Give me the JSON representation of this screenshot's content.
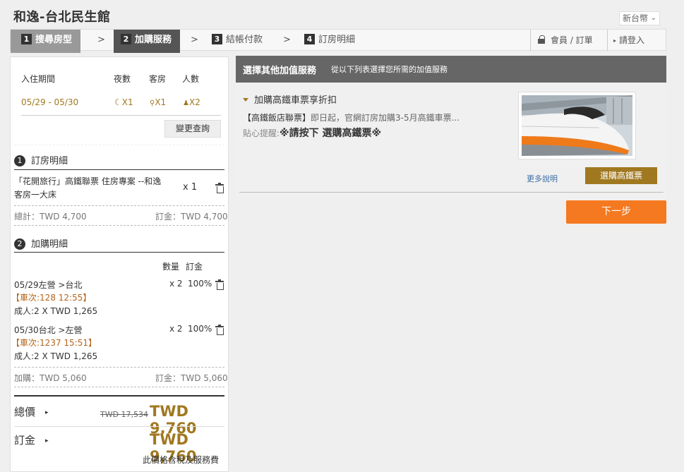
{
  "header": {
    "hotel_name": "和逸-台北民生館",
    "currency": "新台幣"
  },
  "steps": [
    {
      "num": "1",
      "label": "搜尋房型"
    },
    {
      "num": "2",
      "label": "加購服務"
    },
    {
      "num": "3",
      "label": "結帳付款"
    },
    {
      "num": "4",
      "label": "訂房明細"
    }
  ],
  "nav": {
    "member_orders": "會員 / 訂單",
    "login": "請登入",
    "arrow": ">"
  },
  "booking": {
    "headers": {
      "period": "入住期間",
      "nights": "夜數",
      "rooms": "客房",
      "guests": "人數"
    },
    "period": "05/29 - 05/30",
    "nights": "X1",
    "rooms": "X1",
    "guests": "X2",
    "change_button": "變更查詢"
  },
  "room_detail": {
    "section_num": "1",
    "title": "訂房明細",
    "item_line1": "「花開旅行」高鐵聯票 住房專案 --和逸",
    "item_line2": "客房一大床",
    "qty": "x 1",
    "subtotal": "總計：TWD 4,700",
    "deposit": "訂金：TWD 4,700"
  },
  "addon_detail": {
    "section_num": "2",
    "title": "加購明細",
    "col_qty": "數量",
    "col_deposit": "訂金",
    "items": [
      {
        "route": "05/29左營 >台北",
        "train": "【車次:128 12:55】",
        "fare": "成人:2 X TWD 1,265",
        "qty": "x 2",
        "pct": "100%"
      },
      {
        "route": "05/30台北 >左營",
        "train": "【車次:1237 15:51】",
        "fare": "成人:2 X TWD 1,265",
        "qty": "x 2",
        "pct": "100%"
      }
    ],
    "subtotal": "加購：TWD 5,060",
    "deposit": "訂金：TWD 5,060"
  },
  "totals": {
    "total_label": "總價",
    "original_price": "TWD 17,534",
    "total_price": "TWD 9,760",
    "deposit_label": "訂金",
    "deposit_price": "TWD 9,760",
    "tax_note": "此價格含稅及服務費"
  },
  "addon_panel": {
    "header_title": "選擇其他加值服務",
    "header_sub": "從以下列表選擇您所需的加值服務",
    "item_title": "加購高鐵車票享折扣",
    "desc_bracket": "【高鐵飯店聯票】",
    "desc_text": "即日起，官網訂房加購3-5月高鐵車票...",
    "tip_label": "貼心提醒:",
    "tip_text": "※請按下 選購高鐵票※",
    "more_link": "更多說明",
    "select_button": "選購高鐵票"
  },
  "next_button": "下一步",
  "colors": {
    "accent_gold": "#a07820",
    "orange_button": "#f47920",
    "header_gray": "#666666",
    "link_blue": "#3a6ea5"
  }
}
